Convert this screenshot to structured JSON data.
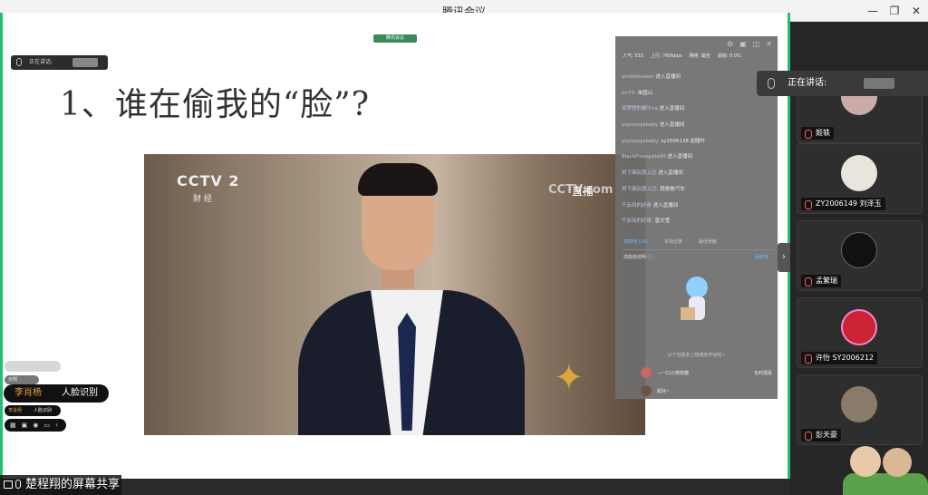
{
  "app": {
    "title": "腾讯会议"
  },
  "window": {
    "minimize": "—",
    "restore": "❐",
    "close": "✕"
  },
  "share": {
    "tag": "腾讯会议",
    "label": "楚程翔的屏幕共享"
  },
  "speaking_top": {
    "label": "正在讲话:"
  },
  "slide": {
    "title": "1、谁在偷我的“脸”?"
  },
  "video": {
    "logo": "CCTV 2",
    "logo_sub": "财 经",
    "live": "直播",
    "watermark": "CCTV.com"
  },
  "chat": {
    "stats": {
      "popularity": "人气: 533",
      "upload": "上行: 760kbps",
      "network": "网络: 最佳",
      "loss": "丢帧: 0.0%"
    },
    "messages": [
      {
        "user": "ambitiousest",
        "text": "进入直播间"
      },
      {
        "user": "Jm73: ",
        "text": "朱国山"
      },
      {
        "user": "肯梦想的蜗牛ha",
        "text": "进入直播间"
      },
      {
        "user": "yoyoyayababy",
        "text": "进入直播间"
      },
      {
        "user": "yoyoyayababy: ",
        "text": "sy2006138 赵國叶"
      },
      {
        "user": "BlackPineapple99",
        "text": "进入直播间"
      },
      {
        "user": "到下面玩耍上压",
        "text": "进入直播间"
      },
      {
        "user": "到下面玩耍上压: ",
        "text": "我想看汽车"
      },
      {
        "user": "千反田的好奇",
        "text": "进入直播间"
      },
      {
        "user": "千反田的好奇: ",
        "text": "曾文莹"
      }
    ],
    "tabs": [
      "高能榜 (36)",
      "本场记录",
      "最佳贡献"
    ],
    "section": "高能榜说明 ⓘ",
    "section_right": "贡献值",
    "empty": "以下当前未上榜或未开始呢~",
    "rows": [
      {
        "label": "—一口小熊软糖",
        "right": "长时观看"
      },
      {
        "label": "挺好~",
        "right": ""
      }
    ]
  },
  "collapse": "›",
  "left": {
    "p2": "示例",
    "name": "李肖杨",
    "feature": "人脸识别",
    "small_name": "李肖杨",
    "small_feature": "人脸识别",
    "icons": [
      "▦",
      "▣",
      "◉",
      "▭",
      "‹"
    ]
  },
  "speaking_right": {
    "label": "正在讲话:"
  },
  "participants": [
    {
      "name": "姬轶"
    },
    {
      "name": "ZY2006149 刘泽玉"
    },
    {
      "name": "孟繁瑞"
    },
    {
      "name": "许怡 SY2006212"
    },
    {
      "name": "彭天豪"
    }
  ]
}
